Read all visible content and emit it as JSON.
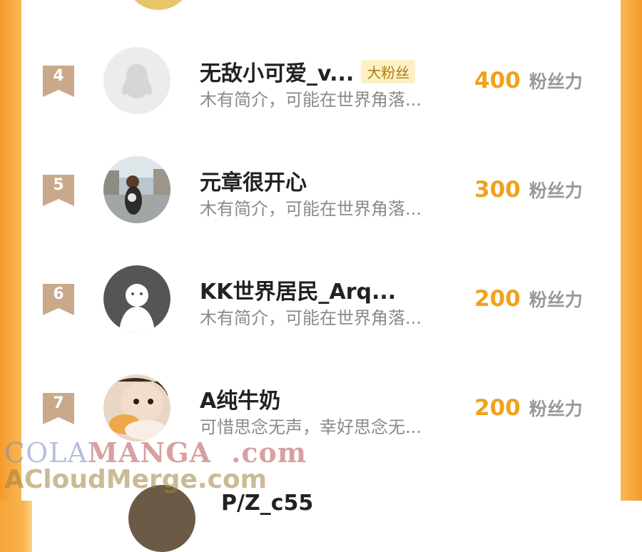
{
  "rows": [
    {
      "rank": "4",
      "name": "无敌小可爱_v...",
      "tag": "大粉丝",
      "bio": "木有简介，可能在世界角落...",
      "score": "400",
      "unit": "粉丝力",
      "avatar": "default-penguin-avatar"
    },
    {
      "rank": "5",
      "name": "元章很开心",
      "tag": "",
      "bio": "木有简介，可能在世界角落...",
      "score": "300",
      "unit": "粉丝力",
      "avatar": "photo-avatar"
    },
    {
      "rank": "6",
      "name": "KK世界居民_Arq...",
      "tag": "",
      "bio": "木有简介，可能在世界角落...",
      "score": "200",
      "unit": "粉丝力",
      "avatar": "default-dark-avatar"
    },
    {
      "rank": "7",
      "name": "A纯牛奶",
      "tag": "",
      "bio": "可惜思念无声，幸好思念无...",
      "score": "200",
      "unit": "粉丝力",
      "avatar": "baby-photo-avatar"
    }
  ],
  "partial_next_name": "P/Z_c55",
  "watermark": {
    "line1_a": "COLA",
    "line1_b": "MANGA",
    "line1_c": ".com",
    "line2": "ACloudMerge.com"
  },
  "colors": {
    "accent": "#f0a21b",
    "frame": "#f7a63a",
    "badge": "#c9a98a",
    "tag_bg": "#fdf0c4"
  }
}
